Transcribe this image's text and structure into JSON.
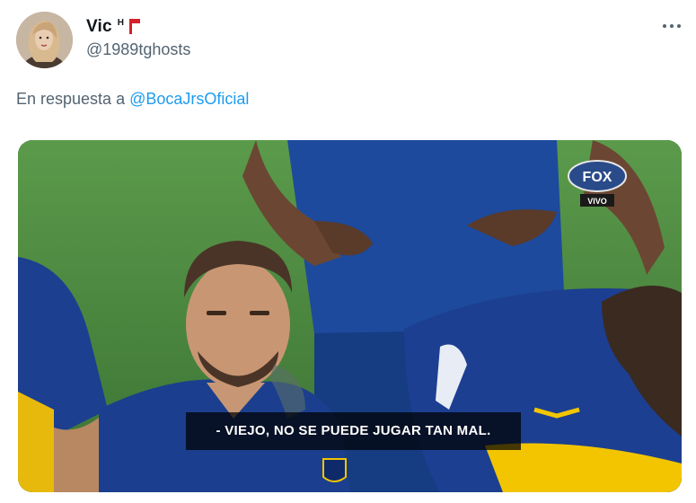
{
  "user": {
    "display_name": "Vic",
    "name_superscript": "H",
    "handle": "@1989tghosts",
    "avatar_icon": "profile-photo-avatar"
  },
  "reply": {
    "prefix": "En respuesta a",
    "mention": "@BocaJrsOficial"
  },
  "menu": {
    "icon": "more-horizontal-icon"
  },
  "media": {
    "broadcaster_logo": "FOX",
    "broadcaster_tag": "VIVO",
    "subtitle": "- VIEJO, NO SE PUEDE JUGAR TAN MAL.",
    "colors": {
      "pitch": "#3f7a36",
      "jersey_blue": "#1d3f8f",
      "jersey_yellow": "#f2c500"
    }
  }
}
